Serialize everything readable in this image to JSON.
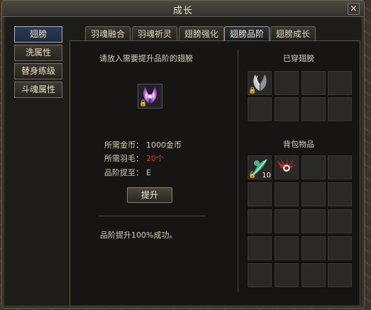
{
  "window": {
    "title": "成长",
    "close_label": "×"
  },
  "sidebar": {
    "items": [
      {
        "label": "翅膀"
      },
      {
        "label": "洗属性"
      },
      {
        "label": "替身练级"
      },
      {
        "label": "斗魂属性"
      }
    ]
  },
  "tabs": [
    {
      "label": "羽魂融合"
    },
    {
      "label": "羽魂祈灵"
    },
    {
      "label": "翅膀强化"
    },
    {
      "label": "翅膀品阶"
    },
    {
      "label": "翅膀成长"
    }
  ],
  "upgrade_panel": {
    "prompt": "请放入需要提升品阶的翅膀",
    "gold_label": "所需金币：",
    "gold_value": "1000金币",
    "feather_label": "所需羽毛：",
    "feather_value": "20个",
    "grade_label": "品阶提至：",
    "grade_value": "E",
    "upgrade_button": "提升",
    "result_text": "品阶提升100%成功。",
    "lock_glyph": "🔒"
  },
  "equipped": {
    "title": "已穿翅膀"
  },
  "backpack": {
    "title": "背包物品",
    "stack_count": "10"
  },
  "colors": {
    "accent_red": "#d43b2a",
    "panel_bg": "#161513",
    "frame": "#6b6453"
  }
}
